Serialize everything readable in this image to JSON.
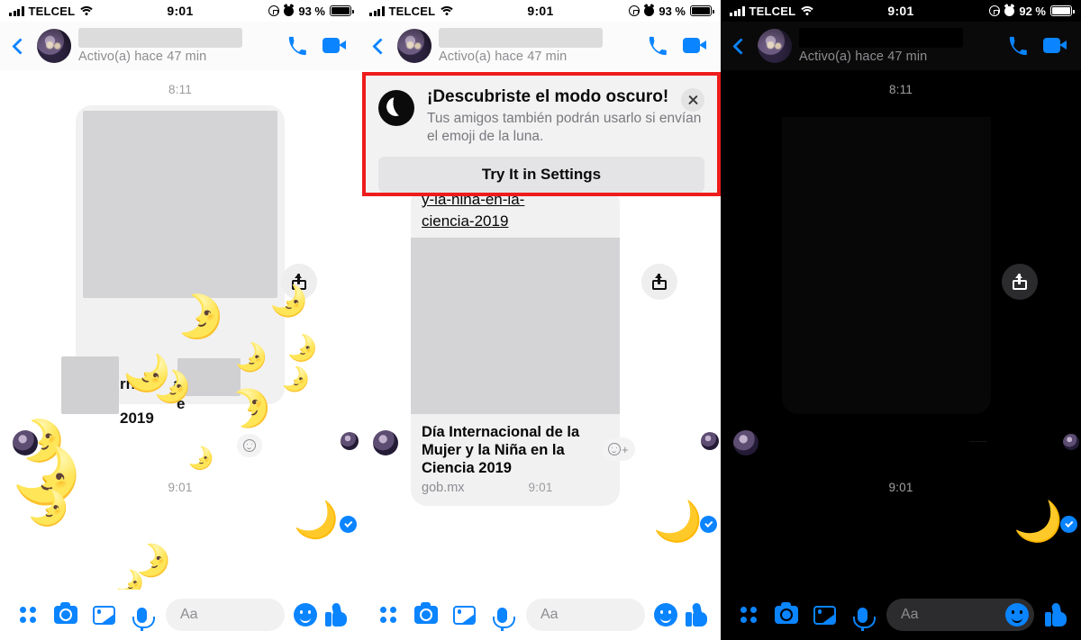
{
  "panels": [
    {
      "theme": "light",
      "statusbar": {
        "carrier": "TELCEL",
        "time": "9:01",
        "battery": "93 %"
      },
      "header": {
        "status": "Activo(a) hace 47 min"
      },
      "thread": {
        "ts_top": "8:11",
        "ts_bottom": "9:01",
        "text_fragment_a": "rnaci",
        "text_fragment_b": "a",
        "text_fragment_c": "2019",
        "text_fragment_d": "e"
      },
      "composer": {
        "placeholder": "Aa"
      }
    },
    {
      "theme": "light",
      "statusbar": {
        "carrier": "TELCEL",
        "time": "9:01",
        "battery": "93 %"
      },
      "header": {
        "status": "Activo(a) hace 47 min"
      },
      "thread": {
        "ts_top": "8:11",
        "ts_bottom": "9:01",
        "link_line1": "y-la-nina-en-la-",
        "link_line2": "ciencia-2019",
        "card_title": "Día Internacional de la Mujer y la Niña en la Ciencia 2019",
        "card_domain": "gob.mx"
      },
      "composer": {
        "placeholder": "Aa"
      },
      "dark_mode_tooltip": {
        "title": "¡Descubriste el modo oscuro!",
        "subtitle": "Tus amigos también podrán usarlo si envían el emoji de la luna.",
        "cta_label": "Try It in Settings"
      }
    },
    {
      "theme": "dark",
      "statusbar": {
        "carrier": "TELCEL",
        "time": "9:01",
        "battery": "92 %"
      },
      "header": {
        "status": "Activo(a) hace 47 min"
      },
      "thread": {
        "ts_top": "8:11",
        "ts_bottom": "9:01"
      },
      "composer": {
        "placeholder": "Aa"
      }
    }
  ],
  "icons": {
    "back": "back-chevron-icon",
    "call": "phone-icon",
    "video": "video-camera-icon",
    "share": "share-icon",
    "grid": "app-grid-icon",
    "camera": "camera-icon",
    "gallery": "photo-icon",
    "mic": "microphone-icon",
    "emoji": "smiley-icon",
    "like": "thumbs-up-icon",
    "close": "close-icon",
    "moon": "moon-icon",
    "delivered": "delivered-check-icon",
    "wifi": "wifi-icon",
    "signal": "signal-bars-icon",
    "battery": "battery-icon",
    "alarm": "alarm-clock-icon",
    "rotation_lock": "rotation-lock-icon"
  },
  "colors": {
    "accent": "#0a84ff",
    "highlight_border": "#ee1c1c",
    "bubble_light": "#f1f1f2",
    "dark_bg": "#000000"
  },
  "emoji": {
    "moon_face": "🌛",
    "crescent": "🌙"
  }
}
